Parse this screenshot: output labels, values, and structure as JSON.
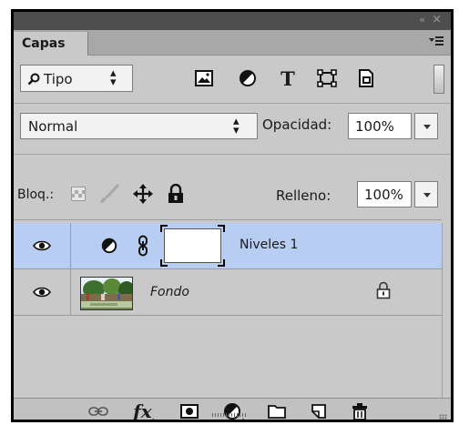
{
  "panel": {
    "tab_label": "Capas",
    "collapse_glyph": "«",
    "close_glyph": "×"
  },
  "filter": {
    "kind_label": "Tipo",
    "stepper_glyph": "▲▼",
    "buttons": [
      "pixel-layer-filter",
      "adjustment-layer-filter",
      "type-layer-filter",
      "shape-layer-filter",
      "smart-object-filter"
    ],
    "type_glyph": "T"
  },
  "blending": {
    "mode": "Normal",
    "opacity_label": "Opacidad:",
    "opacity_value": "100%"
  },
  "lock": {
    "label": "Bloq.:",
    "fill_label": "Relleno:",
    "fill_value": "100%"
  },
  "layers": [
    {
      "name": "Niveles 1",
      "type": "adjustment",
      "selected": true,
      "visible": true
    },
    {
      "name": "Fondo",
      "type": "background",
      "selected": false,
      "visible": true,
      "locked": true
    }
  ],
  "bottom_toolbar": [
    "link-layers",
    "add-layer-style",
    "add-mask",
    "new-fill-adjustment",
    "new-group",
    "new-layer",
    "delete-layer"
  ],
  "bottom_labels": {
    "fx": "fx"
  },
  "colors": {
    "panel_bg": "#c9c9c9",
    "selected_row": "#b8cdf2",
    "titlebar": "#4e4e4e"
  }
}
